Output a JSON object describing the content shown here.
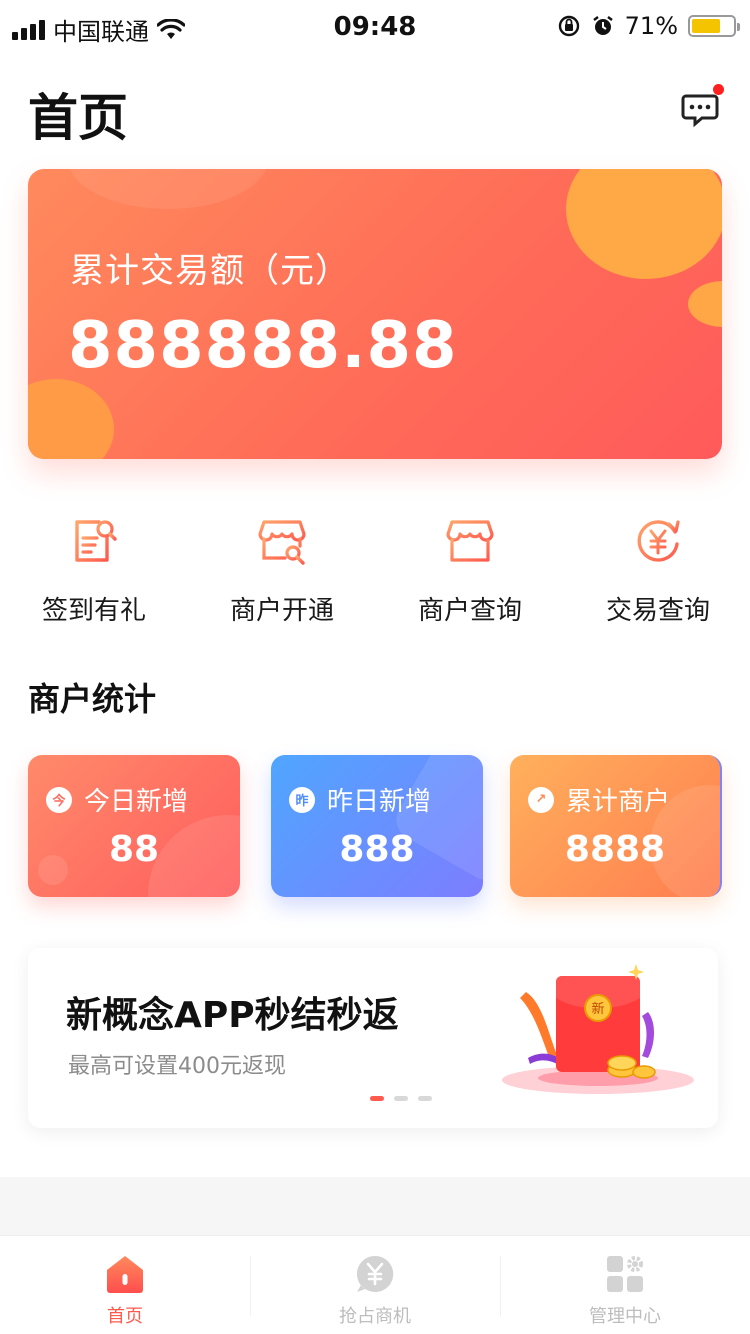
{
  "status_bar": {
    "carrier": "中国联通",
    "time": "09:48",
    "battery": "71%",
    "battery_level": 0.71
  },
  "header": {
    "title": "首页",
    "message_icon": "chat-bubble-icon"
  },
  "hero": {
    "label": "累计交易额（元）",
    "value": "888888.88"
  },
  "quick_actions": [
    {
      "label": "签到有礼",
      "icon": "checkin-document-icon"
    },
    {
      "label": "商户开通",
      "icon": "store-open-icon"
    },
    {
      "label": "商户查询",
      "icon": "store-search-icon"
    },
    {
      "label": "交易查询",
      "icon": "yuan-refresh-icon"
    }
  ],
  "merchant_stats": {
    "title": "商户统计",
    "cards": [
      {
        "label": "今日新增",
        "badge": "今",
        "value": "88"
      },
      {
        "label": "昨日新增",
        "badge": "昨",
        "value": "888"
      },
      {
        "label": "累计商户",
        "badge": "↗",
        "value": "8888"
      }
    ]
  },
  "banner": {
    "title": "新概念APP秒结秒返",
    "subtitle": "最高可设置400元返现",
    "envelope_text": "新",
    "active_dot": 0,
    "dot_count": 3
  },
  "tabbar": {
    "items": [
      {
        "label": "首页",
        "icon": "home-icon",
        "active": true
      },
      {
        "label": "抢占商机",
        "icon": "yuan-chat-icon",
        "active": false
      },
      {
        "label": "管理中心",
        "icon": "grid-settings-icon",
        "active": false
      }
    ]
  },
  "colors": {
    "accent": "#ff5a4e",
    "hero_start": "#ff8a5c",
    "hero_end": "#ff5a5a",
    "blue_card": "#5f95ff",
    "orange_card": "#ff9a55"
  }
}
